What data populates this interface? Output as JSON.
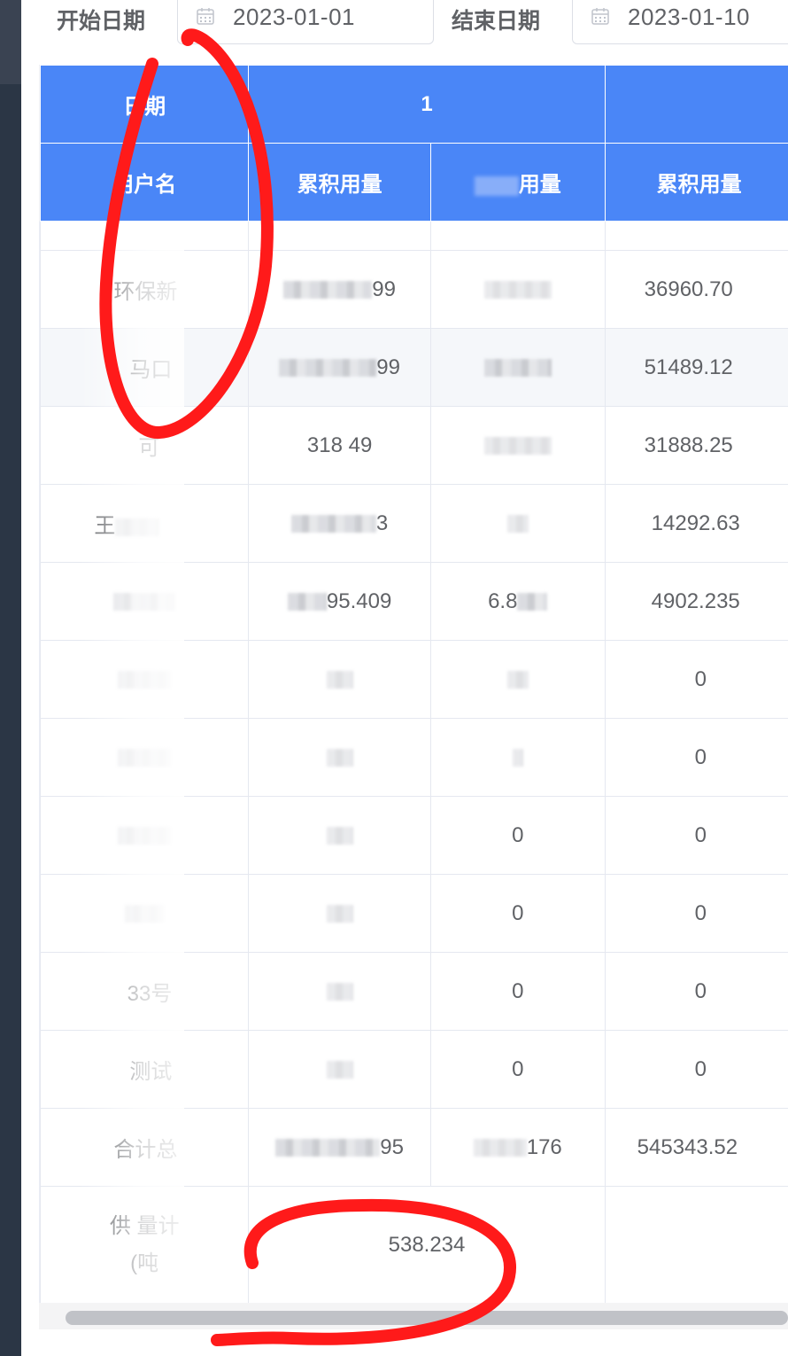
{
  "filters": {
    "start_label": "开始日期",
    "start_value": "2023-01-01",
    "end_label": "结束日期",
    "end_value": "2023-01-10"
  },
  "table": {
    "header_row1": {
      "date_label": "日期",
      "group_label": "1"
    },
    "header_row2": {
      "user_label": "用户名",
      "col1": "累积用量",
      "col2": "用量",
      "col3": "累积用量"
    },
    "rows": [
      {
        "name": "环保新",
        "c1": "99",
        "c2": "",
        "c3": "36960.70"
      },
      {
        "name": "马口",
        "c1": "99",
        "c2": "",
        "c3": "51489.12"
      },
      {
        "name": "可 ",
        "c1": "318 49",
        "c2": "",
        "c3": "31888.25"
      },
      {
        "name": "王",
        "c1": "3",
        "c2": "",
        "c3": "14292.63"
      },
      {
        "name": "",
        "c1": "95.409",
        "c2": "6.8",
        "c3": "4902.235"
      },
      {
        "name": "",
        "c1": "",
        "c2": "",
        "c3": "0"
      },
      {
        "name": "",
        "c1": "",
        "c2": "0",
        "c3": "0"
      },
      {
        "name": "",
        "c1": "",
        "c2": "0",
        "c3": "0"
      },
      {
        "name": "",
        "c1": "",
        "c2": "0",
        "c3": "0"
      },
      {
        "name": "33号",
        "c1": "",
        "c2": "0",
        "c3": "0"
      },
      {
        "name": "测试",
        "c1": "",
        "c2": "0",
        "c3": "0"
      }
    ],
    "total_row": {
      "name": "合计总",
      "c1": "95",
      "c2": "176",
      "c3": "545343.52"
    },
    "supply_row": {
      "name_line1": "供 量计",
      "name_line2": "(吨",
      "value": "538.234"
    }
  },
  "colors": {
    "header_bg": "#4a86f7",
    "annotation": "#ff1a1a"
  }
}
